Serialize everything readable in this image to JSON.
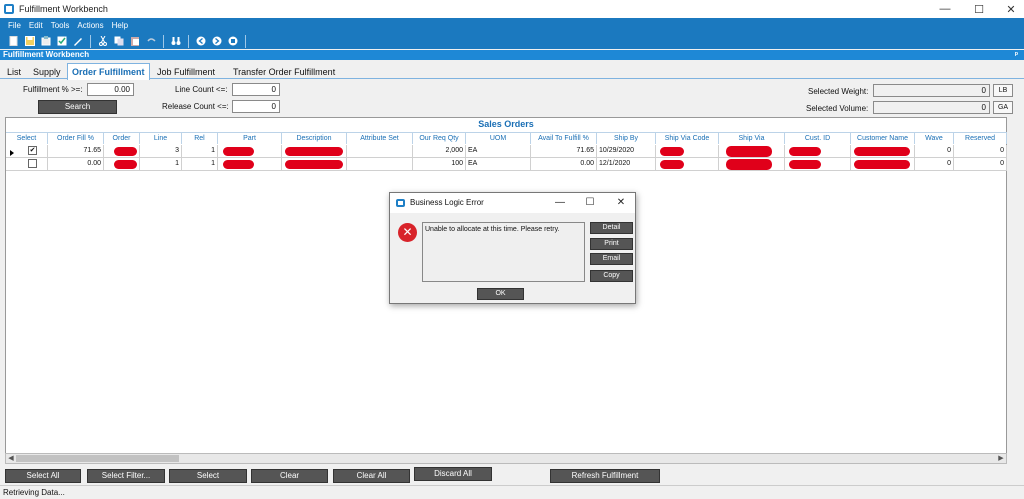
{
  "window": {
    "title": "Fulfillment Workbench",
    "minimize": "—",
    "maximize": "☐",
    "close": "✕"
  },
  "menu": [
    "File",
    "Edit",
    "Tools",
    "Actions",
    "Help"
  ],
  "panel": {
    "title": "Fulfillment Workbench",
    "pin": "ᵖ"
  },
  "tabs": {
    "list": "List",
    "supply": "Supply",
    "order_fulfillment": "Order Fulfillment",
    "job_fulfillment": "Job Fulfillment",
    "transfer_order_fulfillment": "Transfer Order Fulfillment"
  },
  "filters": {
    "fulfillment_label": "Fulfillment % >=:",
    "fulfillment_value": "0.00",
    "line_count_label": "Line Count <=:",
    "line_count_value": "0",
    "release_count_label": "Release Count <=:",
    "release_count_value": "0",
    "search_label": "Search"
  },
  "selected": {
    "weight_label": "Selected Weight:",
    "weight_value": "0",
    "weight_unit": "LB",
    "volume_label": "Selected Volume:",
    "volume_value": "0",
    "volume_unit": "GA"
  },
  "grid": {
    "title": "Sales Orders",
    "headers": [
      "Select",
      "Order Fill %",
      "Order",
      "Line",
      "Rel",
      "Part",
      "Description",
      "Attribute Set",
      "Our Req Qty",
      "UOM",
      "Avail To Fulfill %",
      "Ship By",
      "Ship Via Code",
      "Ship Via",
      "Cust. ID",
      "Customer Name",
      "Wave",
      "Reserved"
    ],
    "rows": [
      {
        "checked": "✔",
        "fill": "71.65",
        "line": "3",
        "rel": "1",
        "qty": "2,000",
        "uom": "EA",
        "avail": "71.65",
        "shipby": "10/29/2020",
        "wave": "0",
        "reserved": "0"
      },
      {
        "checked": "",
        "fill": "0.00",
        "line": "1",
        "rel": "1",
        "qty": "100",
        "uom": "EA",
        "avail": "0.00",
        "shipby": "12/1/2020",
        "wave": "0",
        "reserved": "0"
      }
    ]
  },
  "scroll": {
    "left": "◀",
    "right": "▶"
  },
  "buttons": {
    "select_all": "Select All",
    "select_filter": "Select Filter...",
    "select": "Select",
    "clear": "Clear",
    "clear_all": "Clear All",
    "discard_all": "Discard All",
    "refresh_fulfillment": "Refresh Fulfillment"
  },
  "status": "Retrieving Data...",
  "dialog": {
    "title": "Business Logic Error",
    "minimize": "—",
    "maximize": "☐",
    "close": "✕",
    "icon": "✕",
    "message": "Unable to allocate at this time.  Please retry.",
    "detail": "Detail",
    "print": "Print",
    "email": "Email",
    "copy": "Copy",
    "ok": "OK"
  },
  "colors": {
    "accent": "#1b79bf",
    "header_text": "#1a6fb5",
    "error": "#d8232a",
    "redaction": "#e0001a"
  },
  "icons": [
    "new-icon",
    "save-icon",
    "attach-icon",
    "check-icon",
    "edit-icon",
    "cut-icon",
    "copy-icon",
    "paste-icon",
    "undo-icon",
    "binoculars-icon",
    "back-icon",
    "forward-icon",
    "stop-icon"
  ]
}
